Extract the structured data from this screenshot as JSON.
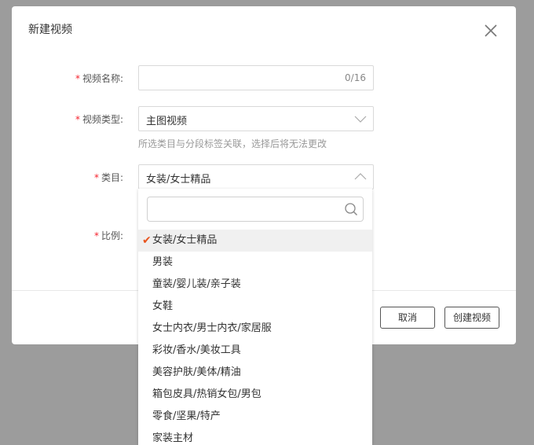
{
  "modal": {
    "title": "新建视频",
    "cancel_label": "取消",
    "create_label": "创建视频"
  },
  "form": {
    "name": {
      "label": "视频名称:",
      "value": "",
      "counter": "0/16"
    },
    "type": {
      "label": "视频类型:",
      "value": "主图视频",
      "hint": "所选类目与分段标签关联，选择后将无法更改"
    },
    "category": {
      "label": "类目:",
      "value": "女装/女士精品"
    },
    "ratio": {
      "label": "比例:"
    },
    "required_mark": "*"
  },
  "dropdown": {
    "search_placeholder": "",
    "selected_index": 0,
    "check_glyph": "✔",
    "items": [
      "女装/女士精品",
      "男装",
      "童装/婴儿装/亲子装",
      "女鞋",
      "女士内衣/男士内衣/家居服",
      "彩妆/香水/美妆工具",
      "美容护肤/美体/精油",
      "箱包皮具/热销女包/男包",
      "零食/坚果/特产",
      "家装主材"
    ]
  },
  "colors": {
    "overlay": "#9c9c9c",
    "required": "#f5222d",
    "check": "#e8541e"
  }
}
